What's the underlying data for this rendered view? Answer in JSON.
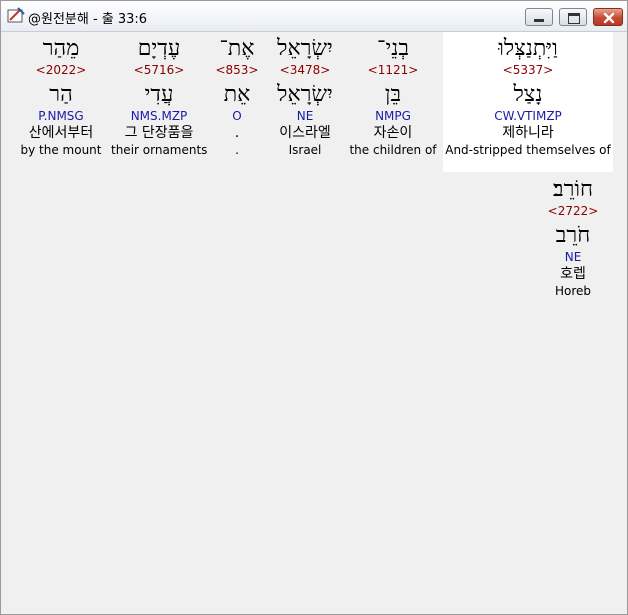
{
  "window": {
    "title": "@원전분해 - 출 33:6"
  },
  "line1": [
    {
      "hebrew": "וַיִּתְנַצְּלוּ",
      "strong": "<5337>",
      "lemma": "נָצַל",
      "morph": "CW.VTIMZP",
      "korean": "제하니라",
      "english": "And-stripped themselves of"
    },
    {
      "hebrew": "בְנֵי־",
      "strong": "<1121>",
      "lemma": "בֵּן",
      "morph": "NMPG",
      "korean": "자손이",
      "english": "the children of"
    },
    {
      "hebrew": "יִשְׂרָאֵל",
      "strong": "<3478>",
      "lemma": "יִשְׂרָאֵל",
      "morph": "NE",
      "korean": "이스라엘",
      "english": "Israel"
    },
    {
      "hebrew": "אֶת־",
      "strong": "<853>",
      "lemma": "אֵת",
      "morph": "O",
      "korean": ".",
      "english": "."
    },
    {
      "hebrew": "עֶדְיָם",
      "strong": "<5716>",
      "lemma": "עֲדִי",
      "morph": "NMS.MZP",
      "korean": "그 단장품을",
      "english": "their ornaments"
    },
    {
      "hebrew": "מֵהַר",
      "strong": "<2022>",
      "lemma": "הַר",
      "morph": "P.NMSG",
      "korean": "산에서부터",
      "english": "by the mount"
    }
  ],
  "line2": [
    {
      "hebrew": "חוֹרֵב׃",
      "strong": "<2722>",
      "lemma": "חֹרֵב",
      "morph": "NE",
      "korean": "호렙",
      "english": "Horeb"
    }
  ]
}
